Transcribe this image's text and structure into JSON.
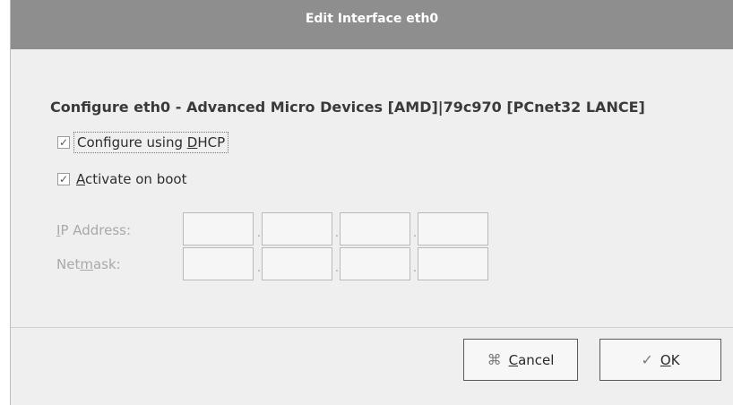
{
  "dialog": {
    "title": "Edit Interface eth0",
    "heading": "Configure eth0 - Advanced Micro Devices [AMD]|79c970 [PCnet32 LANCE]"
  },
  "options": {
    "dhcp": {
      "label_pre": "Configure using ",
      "label_mnemonic": "D",
      "label_post": "HCP",
      "checked": true,
      "check_glyph": "✓"
    },
    "boot": {
      "label_pre": "",
      "label_mnemonic": "A",
      "label_post": "ctivate on boot",
      "checked": true,
      "check_glyph": "✓"
    }
  },
  "fields": {
    "ip": {
      "label_pre": "",
      "label_mnemonic": "I",
      "label_post": "P Address:",
      "octets": [
        "",
        "",
        "",
        ""
      ],
      "separator": "."
    },
    "netmask": {
      "label_pre": "Net",
      "label_mnemonic": "m",
      "label_post": "ask:",
      "octets": [
        "",
        "",
        "",
        ""
      ],
      "separator": "."
    }
  },
  "buttons": {
    "cancel": {
      "icon": "cancel-icon",
      "glyph": "⌘",
      "label_pre": "",
      "label_mnemonic": "C",
      "label_post": "ancel"
    },
    "ok": {
      "icon": "check-icon",
      "glyph": "✓",
      "label_pre": "",
      "label_mnemonic": "O",
      "label_post": "K"
    }
  }
}
